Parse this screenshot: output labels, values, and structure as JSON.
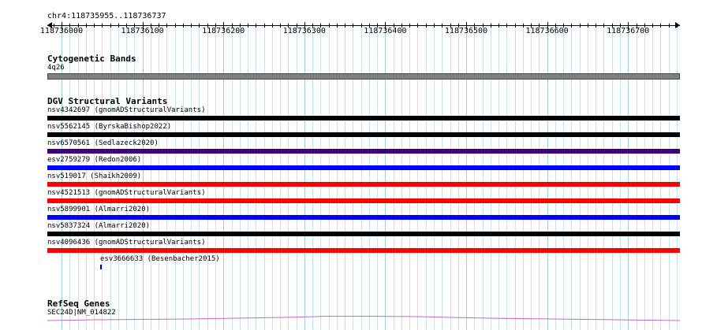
{
  "location": "chr4:118735955..118736737",
  "ruler": {
    "tick_labels": [
      "118736000",
      "118736100",
      "118736200",
      "118736300",
      "118736400",
      "118736500",
      "118736600",
      "118736700"
    ]
  },
  "tracks": {
    "cytoband": {
      "title": "Cytogenetic Bands",
      "label": "4q26",
      "color": "#808080"
    },
    "dgv": {
      "title": "DGV Structural Variants",
      "items": [
        {
          "label": "nsv4342697 (gnomADStructuralVariants)",
          "color": "#000000"
        },
        {
          "label": "nsv5562145 (ByrskaBishop2022)",
          "color": "#000000"
        },
        {
          "label": "nsv6570561 (Sedlazeck2020)",
          "color": "#400080"
        },
        {
          "label": "esv2759279 (Redon2006)",
          "color": "#0000ff"
        },
        {
          "label": "nsv519017 (Shaikh2009)",
          "color": "#ff0000"
        },
        {
          "label": "nsv4521513 (gnomADStructuralVariants)",
          "color": "#ff0000"
        },
        {
          "label": "nsv5899901 (Almarri2020)",
          "color": "#0000ff"
        },
        {
          "label": "nsv5837324 (Almarri2020)",
          "color": "#000000"
        },
        {
          "label": "nsv4096436 (gnomADStructuralVariants)",
          "color": "#ff0000"
        }
      ],
      "small_item": {
        "label": "esv3666633 (Besenbacher2015)",
        "color": "#0000cc"
      }
    },
    "refseq": {
      "title": "RefSeq Genes",
      "label": "SEC24D|NM_014822",
      "color": "#cc66cc"
    }
  }
}
